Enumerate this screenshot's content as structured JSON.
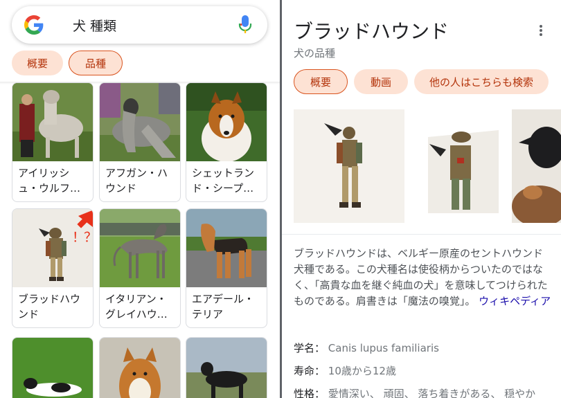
{
  "search": {
    "query": "犬 種類"
  },
  "left_chips": [
    {
      "label": "概要"
    },
    {
      "label": "品種"
    }
  ],
  "breeds": [
    {
      "name": "アイリッシュ・ウルフ…"
    },
    {
      "name": "アフガン・ハウンド"
    },
    {
      "name": "シェットランド・シープ…"
    },
    {
      "name": "ブラッドハウンド"
    },
    {
      "name": "イタリアン・グレイハウ…"
    },
    {
      "name": "エアデール・テリア"
    }
  ],
  "annotation": {
    "text": "！？",
    "color": "#e8311a"
  },
  "panel": {
    "title": "ブラッドハウンド",
    "subtitle": "犬の品種",
    "chips": [
      {
        "label": "概要"
      },
      {
        "label": "動画"
      },
      {
        "label": "他の人はこちらも検索"
      }
    ],
    "description": "ブラッドハウンドは、ベルギー原産のセントハウンド犬種である。この犬種名は使役柄からついたのではなく、「高貴な血を継ぐ純血の犬」を意味してつけられたものである。肩書きは「魔法の嗅覚」。",
    "source": "ウィキペディア",
    "facts": [
      {
        "key": "学名：",
        "value": "Canis lupus familiaris"
      },
      {
        "key": "寿命：",
        "value": "10歳から12歳"
      },
      {
        "key": "性格：",
        "value": "愛情深い、 頑固、 落ち着きがある、 穏やか"
      }
    ]
  },
  "colors": {
    "chip_bg": "#fde2d4",
    "chip_text": "#b3330a",
    "link": "#1a0dab",
    "accent": "#d9531e"
  }
}
